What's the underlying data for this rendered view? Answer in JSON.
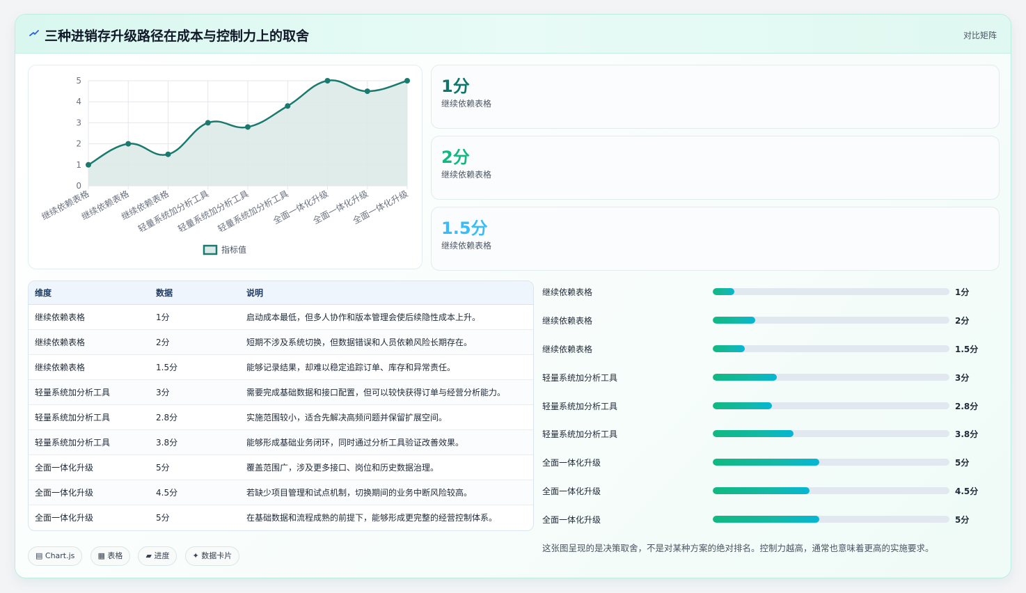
{
  "header": {
    "title": "三种进销存升级路径在成本与控制力上的取舍",
    "tag": "对比矩阵"
  },
  "chart_data": {
    "type": "line",
    "categories": [
      "继续依赖表格",
      "继续依赖表格",
      "继续依赖表格",
      "轻量系统加分析工具",
      "轻量系统加分析工具",
      "轻量系统加分析工具",
      "全面一体化升级",
      "全面一体化升级",
      "全面一体化升级"
    ],
    "series": [
      {
        "name": "指标值",
        "values": [
          1,
          2,
          1.5,
          3,
          2.8,
          3.8,
          5,
          4.5,
          5
        ]
      }
    ],
    "ylim": [
      0,
      5
    ],
    "yticks": [
      "0",
      "1",
      "2",
      "3",
      "4",
      "5"
    ],
    "grid": true,
    "legend": "bottom",
    "colors": {
      "line": "#1a7a6e",
      "fill": "#dbeae8"
    }
  },
  "metrics": [
    {
      "value": "1分",
      "label": "继续依赖表格",
      "color": "#0f766e"
    },
    {
      "value": "2分",
      "label": "继续依赖表格",
      "color": "#10b981"
    },
    {
      "value": "1.5分",
      "label": "继续依赖表格",
      "color": "#38bdf8"
    }
  ],
  "table": {
    "headers": [
      "维度",
      "数据",
      "说明"
    ],
    "rows": [
      [
        "继续依赖表格",
        "1分",
        "启动成本最低，但多人协作和版本管理会使后续隐性成本上升。"
      ],
      [
        "继续依赖表格",
        "2分",
        "短期不涉及系统切换，但数据错误和人员依赖风险长期存在。"
      ],
      [
        "继续依赖表格",
        "1.5分",
        "能够记录结果，却难以稳定追踪订单、库存和异常责任。"
      ],
      [
        "轻量系统加分析工具",
        "3分",
        "需要完成基础数据和接口配置，但可以较快获得订单与经营分析能力。"
      ],
      [
        "轻量系统加分析工具",
        "2.8分",
        "实施范围较小，适合先解决高频问题并保留扩展空间。"
      ],
      [
        "轻量系统加分析工具",
        "3.8分",
        "能够形成基础业务闭环，同时通过分析工具验证改善效果。"
      ],
      [
        "全面一体化升级",
        "5分",
        "覆盖范围广，涉及更多接口、岗位和历史数据治理。"
      ],
      [
        "全面一体化升级",
        "4.5分",
        "若缺少项目管理和试点机制，切换期间的业务中断风险较高。"
      ],
      [
        "全面一体化升级",
        "5分",
        "在基础数据和流程成熟的前提下，能够形成更完整的经营控制体系。"
      ]
    ]
  },
  "progress": [
    {
      "label": "继续依赖表格",
      "value": "1分",
      "fraction": 0.09
    },
    {
      "label": "继续依赖表格",
      "value": "2分",
      "fraction": 0.18
    },
    {
      "label": "继续依赖表格",
      "value": "1.5分",
      "fraction": 0.135
    },
    {
      "label": "轻量系统加分析工具",
      "value": "3分",
      "fraction": 0.27
    },
    {
      "label": "轻量系统加分析工具",
      "value": "2.8分",
      "fraction": 0.25
    },
    {
      "label": "轻量系统加分析工具",
      "value": "3.8分",
      "fraction": 0.34
    },
    {
      "label": "全面一体化升级",
      "value": "5分",
      "fraction": 0.45
    },
    {
      "label": "全面一体化升级",
      "value": "4.5分",
      "fraction": 0.41
    },
    {
      "label": "全面一体化升级",
      "value": "5分",
      "fraction": 0.45
    }
  ],
  "note": "这张图呈现的是决策取舍，不是对某种方案的绝对排名。控制力越高，通常也意味着更高的实施要求。",
  "chips": [
    "▤ Chart.js",
    "▦ 表格",
    "▰ 进度",
    "✦ 数据卡片"
  ]
}
